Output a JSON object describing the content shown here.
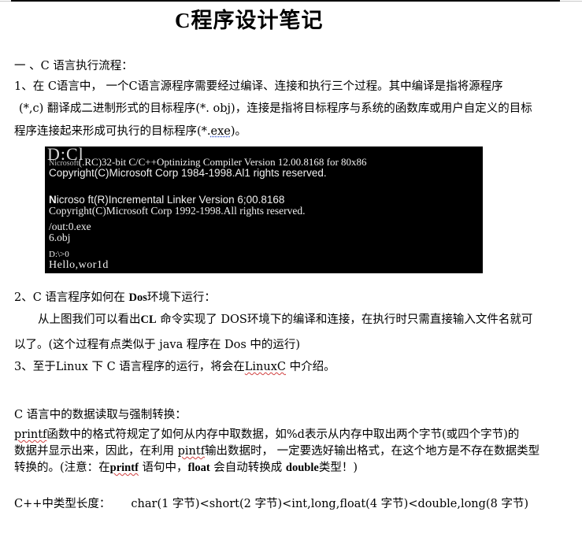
{
  "document": {
    "title": "C程序设计笔记",
    "section1": {
      "heading": "一 、C  语言执行流程：",
      "item1_line1": "1、在 C语言中，  一个C语言源程序需要经过编译、连接和执行三个过程。其中编译是指将源程序",
      "item1_line2_a": "(*,c)  翻译成二进制形式的目标程序(*. obj)，连接是指将目标程序与系统的函数库或用户自定义的目标",
      "item1_line3_a": "程序连接起来形成可执行的目标程序(*.",
      "item1_line3_ext": "exe",
      "item1_line3_b": ")。"
    },
    "terminal": {
      "overlay": "D:Cl",
      "line1_prefix": "Nicrosoft",
      "line1_rest": "(.RC)32-bit   C/C++Optinizing   Compiler  Version    12.00.8168    for    80x86",
      "line2": "Copyright(C)Microsoft   Corp    1984-1998.Al1   rights   reserved.",
      "line3_bold_initial": "N",
      "line3": "icroso ft(R)Incremental   Linker   Version   6;00.8168",
      "line4": "Copyright(C)Microsoft   Corp    1992-1998.All    rights    reserved.",
      "line5": "/out:0.exe",
      "line6": "6.obj",
      "line7": "D:\\>0",
      "line8": "Hello,wor1d"
    },
    "section2": {
      "heading_a": "2、C 语言程序如何在 ",
      "heading_bold": "Dos",
      "heading_b": "环境下运行：",
      "para_line1_a": "从上图我们可以看出",
      "para_line1_bold": "CL",
      "para_line1_b": " 命令实现了 DOS环境下的编译和连接，在执行时只需直接输入文件名就可",
      "para_line2": "以了。(这个过程有点类似于 java 程序在 Dos 中的运行)"
    },
    "section3": {
      "text_a": "3、至于Linux 下 C 语言程序的运行，将会在",
      "text_link": "LinuxC",
      "text_b": " 中介绍。"
    },
    "section4": {
      "heading": "C 语言中的数据读取与强制转换：",
      "para_line1_link": "printf",
      "para_line1_rest": "函数中的格式符规定了如何从内存中取数据，如%d表示从内存中取出两个字节(或四个字节)的",
      "para_line2_a": "数据并显示出来，因此，在利用 ",
      "para_line2_link": "pintf",
      "para_line2_b": "输出数据时，  一定要选好输出格式，在这个地方是不存在数据类型",
      "para_line3_a": "转换的。(注意：在",
      "para_line3_bold1": "printf",
      "para_line3_b": " 语句中，",
      "para_line3_bold2": "float",
      "para_line3_c": " 会自动转换成 ",
      "para_line3_bold3": "double",
      "para_line3_d": "类型！)"
    },
    "section5": {
      "label": "C++中类型长度：",
      "value": "char(1 字节)<short(2    字节)<int,long,float(4     字节)<double,long(8     字节)"
    }
  }
}
